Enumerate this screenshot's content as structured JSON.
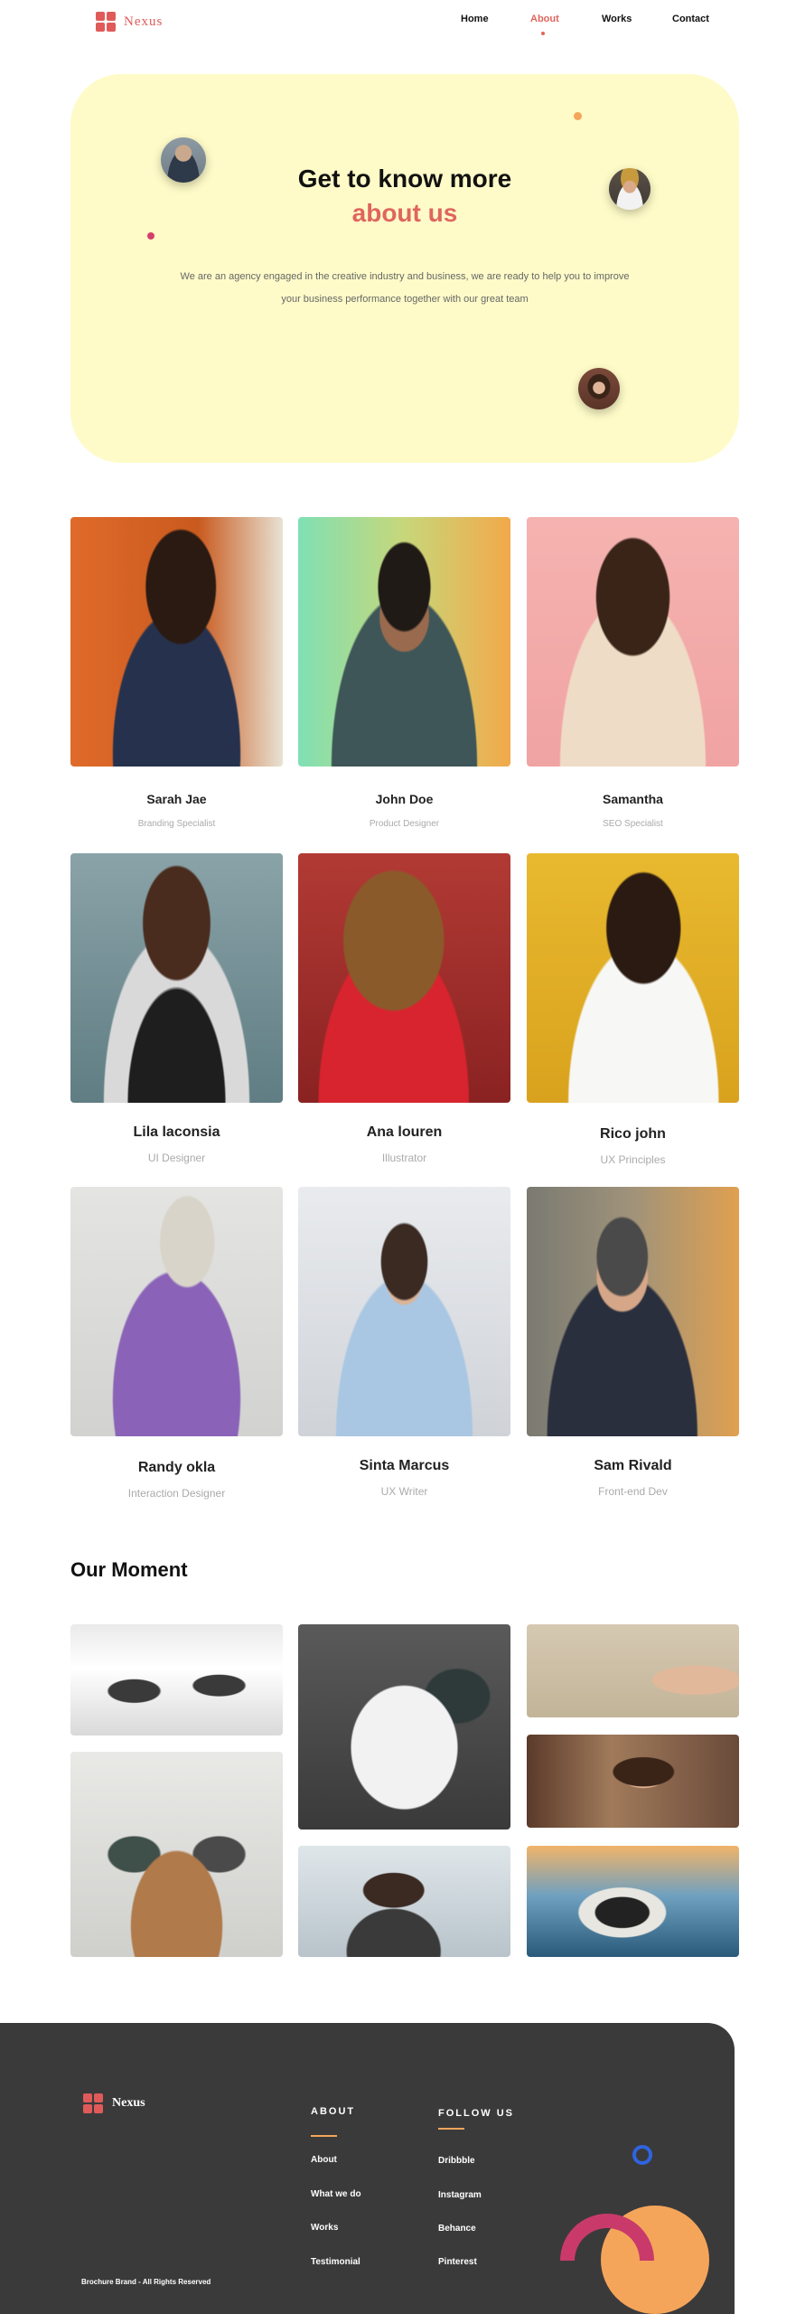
{
  "nav": {
    "brand": "Nexus",
    "links": [
      {
        "label": "Home",
        "active": false
      },
      {
        "label": "About",
        "active": true
      },
      {
        "label": "Works",
        "active": false
      },
      {
        "label": "Contact",
        "active": false
      }
    ]
  },
  "hero": {
    "title_line1": "Get to know more",
    "title_line2": "about us",
    "description": "We are an agency engaged in the creative industry and business, we are ready to help you to improve your business performance together with our great team"
  },
  "team": [
    {
      "name": "Sarah Jae",
      "role": "Branding Specialist"
    },
    {
      "name": "John Doe",
      "role": "Product Designer"
    },
    {
      "name": "Samantha",
      "role": "SEO Specialist"
    },
    {
      "name": "Lila laconsia",
      "role": "UI Designer"
    },
    {
      "name": "Ana louren",
      "role": "Illustrator"
    },
    {
      "name": "Rico john",
      "role": "UX Principles"
    },
    {
      "name": "Randy okla",
      "role": "Interaction Designer"
    },
    {
      "name": "Sinta Marcus",
      "role": "UX Writer"
    },
    {
      "name": "Sam Rivald",
      "role": "Front-end Dev"
    }
  ],
  "moment": {
    "title": "Our Moment"
  },
  "footer": {
    "brand": "Nexus",
    "copyright": "Brochure Brand - All Rights Reserved",
    "about": {
      "title": "ABOUT",
      "links": [
        "About",
        "What we do",
        "Works",
        "Testimonial"
      ]
    },
    "follow": {
      "title": "FOLLOW US",
      "links": [
        "Dribbble",
        "Instagram",
        "Behance",
        "Pinterest"
      ]
    }
  },
  "colors": {
    "accent": "#e0655d",
    "hero_bg": "#fefbc8",
    "footer_bg": "#3b3a3b",
    "footer_line": "#f4a55a"
  }
}
